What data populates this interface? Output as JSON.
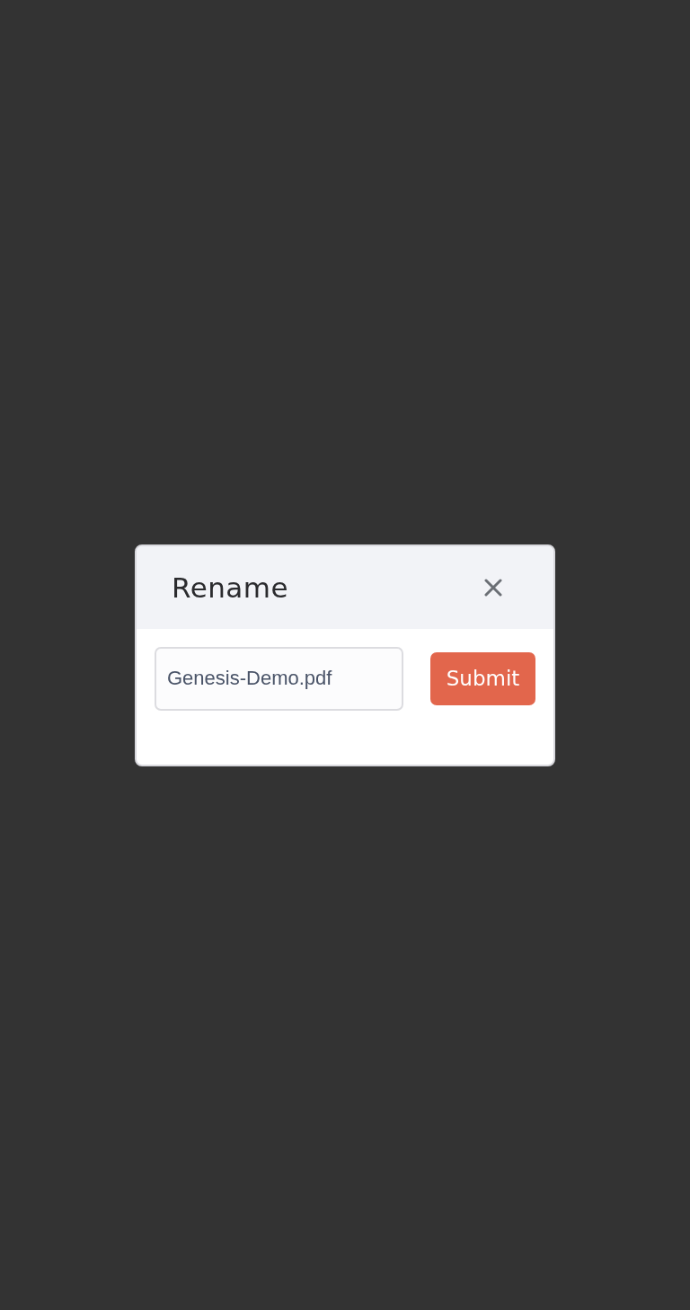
{
  "dialog": {
    "title": "Rename",
    "input": {
      "value": "Genesis-Demo.pdf"
    },
    "submit_button": {
      "label": "Submit"
    }
  }
}
